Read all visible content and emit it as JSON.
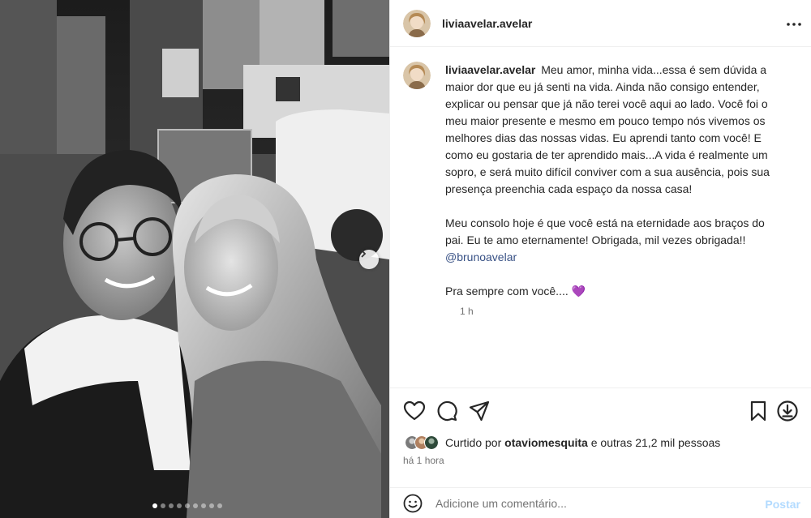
{
  "post": {
    "username": "liviaavelar.avelar",
    "more_icon": "more-horizontal-icon"
  },
  "caption": {
    "username": "liviaavelar.avelar",
    "paragraph1": "Meu amor, minha vida...essa é sem dúvida a maior dor que eu já senti na vida. Ainda não consigo entender, explicar ou pensar que já não terei você aqui ao lado. Você foi o meu maior presente e mesmo em pouco tempo nós vivemos os melhores dias das nossas vidas. Eu aprendi tanto com você! E como eu gostaria de ter aprendido mais...A vida é realmente um sopro, e será muito difícil conviver com a sua ausência, pois sua presença preenchia cada espaço da nossa casa!",
    "paragraph2": "Meu consolo hoje é que você está na eternidade aos braços do pai. Eu te amo eternamente! Obrigada, mil vezes obrigada!!",
    "mention": "@brunoavelar",
    "paragraph3": "Pra sempre com você.... 💜",
    "time": "1 h"
  },
  "actions": {
    "icons": [
      "heart-icon",
      "comment-icon",
      "share-icon",
      "bookmark-icon",
      "download-icon"
    ],
    "liked_prefix": "Curtido por",
    "liked_user": "otaviomesquita",
    "liked_suffix": "e outras 21,2 mil pessoas",
    "posted_ago": "há 1 hora"
  },
  "comment": {
    "placeholder": "Adicione um comentário...",
    "post_label": "Postar",
    "emoji_icon": "emoji-icon"
  },
  "carousel": {
    "total_slides": 9,
    "active_slide": 1
  },
  "colors": {
    "mention": "#385185",
    "post_disabled": "#b3dbff",
    "secondary_text": "#737373"
  }
}
